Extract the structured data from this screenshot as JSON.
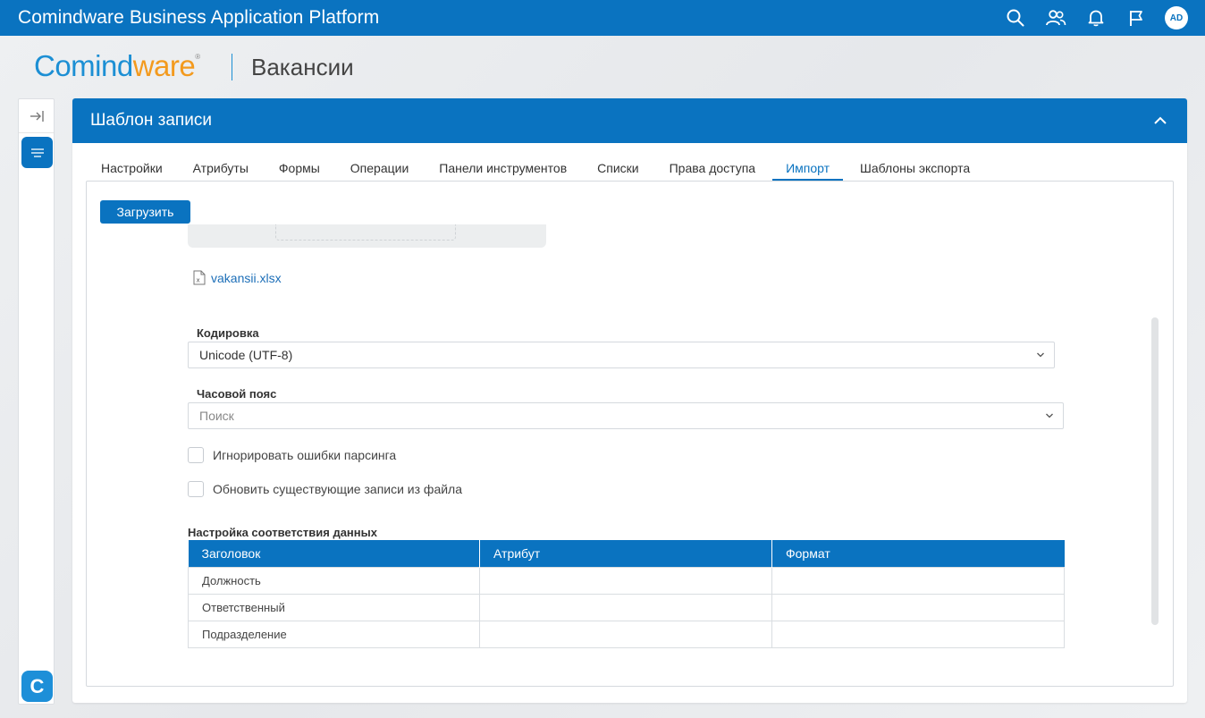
{
  "topbar": {
    "title": "Comindware Business Application Platform",
    "icons": [
      "search-icon",
      "users-icon",
      "bell-icon",
      "flag-icon"
    ],
    "avatar_initials": "AD"
  },
  "header": {
    "logo_part1": "Comind",
    "logo_part2": "ware",
    "logo_mark": "®",
    "page_title": "Вакансии"
  },
  "panel": {
    "title": "Шаблон записи",
    "tabs": [
      {
        "label": "Настройки"
      },
      {
        "label": "Атрибуты"
      },
      {
        "label": "Формы"
      },
      {
        "label": "Операции"
      },
      {
        "label": "Панели инструментов"
      },
      {
        "label": "Списки"
      },
      {
        "label": "Права доступа"
      },
      {
        "label": "Импорт"
      },
      {
        "label": "Шаблоны экспорта"
      }
    ],
    "active_tab": "Импорт"
  },
  "import": {
    "upload_label": "Загрузить",
    "file_name": "vakansii.xlsx",
    "encoding_label": "Кодировка",
    "encoding_value": "Unicode (UTF-8)",
    "timezone_label": "Часовой пояс",
    "timezone_placeholder": "Поиск",
    "ignore_errors_label": "Игнорировать ошибки парсинга",
    "update_existing_label": "Обновить существующие записи из файла",
    "mapping_title": "Настройка соответствия данных",
    "mapping_columns": [
      "Заголовок",
      "Атрибут",
      "Формат"
    ],
    "mapping_rows": [
      [
        "Должность",
        "",
        ""
      ],
      [
        "Ответственный",
        "",
        ""
      ],
      [
        "Подразделение",
        "",
        ""
      ]
    ]
  },
  "colors": {
    "primary": "#0a73c0",
    "logo_blue": "#1c8fd4",
    "logo_orange": "#f39a1e"
  }
}
